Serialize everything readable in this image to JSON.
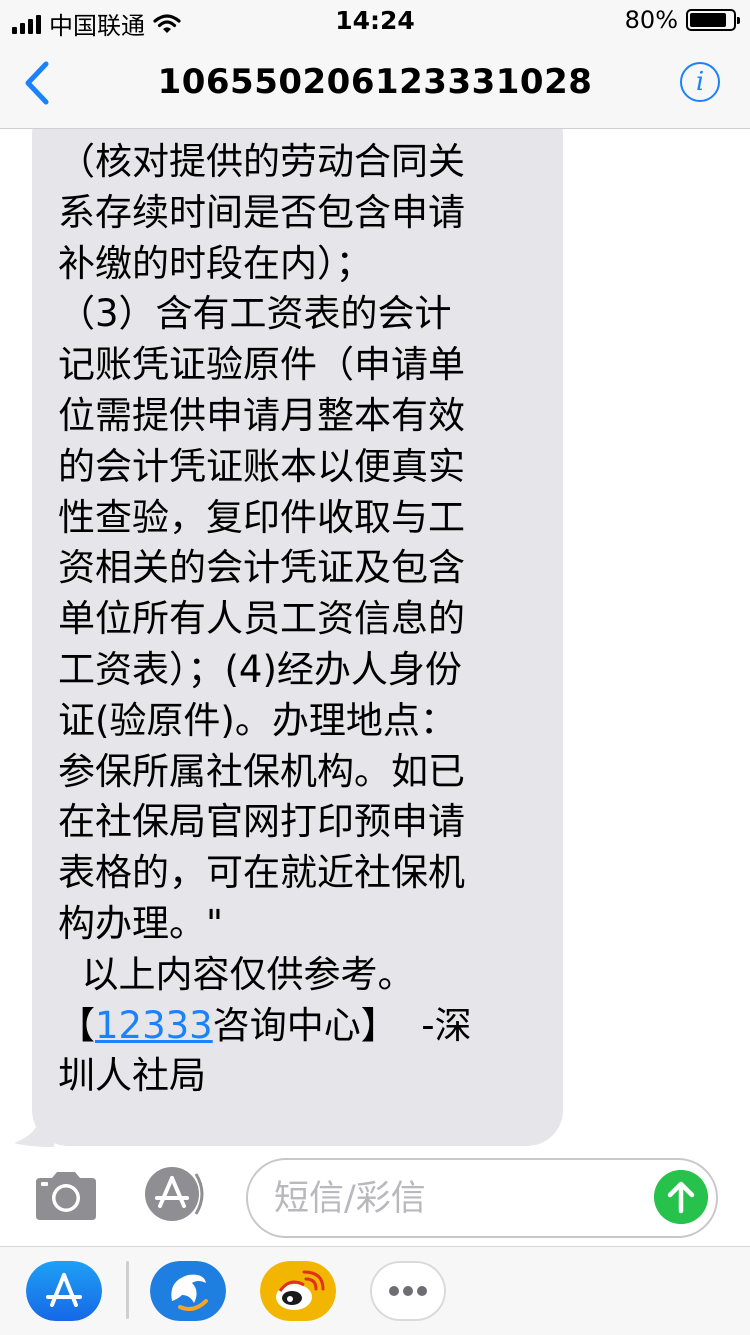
{
  "status_bar": {
    "carrier": "中国联通",
    "time": "14:24",
    "battery": "80%"
  },
  "nav": {
    "title": "106550206123331028",
    "info_label": "i"
  },
  "message": {
    "lines": [
      "（核对提供的劳动合同关",
      "系存续时间是否包含申请",
      "补缴的时段在内）；",
      "（3）含有工资表的会计",
      "记账凭证验原件（申请单",
      "位需提供申请月整本有效",
      "的会计凭证账本以便真实",
      "性查验，复印件收取与工",
      "资相关的会计凭证及包含",
      "单位所有人员工资信息的",
      "工资表）；(4)经办人身份",
      "证(验原件)。办理地点：",
      "参保所属社保机构。如已",
      "在社保局官网打印预申请",
      "表格的，可在就近社保机",
      "构办理。\"",
      "",
      "  以上内容仅供参考。"
    ],
    "footer_prefix": "【",
    "footer_link": "12333",
    "footer_suffix": "咨询中心】  -深",
    "last_line": "圳人社局"
  },
  "input_bar": {
    "placeholder": "短信/彩信",
    "camera_icon": "camera-icon",
    "apps_icon": "app-store-icon",
    "send_icon": "send-arrow-icon"
  },
  "app_tray": {
    "icons": [
      "app-store-icon",
      "dolphin-app-icon",
      "weibo-icon",
      "more-icon"
    ]
  },
  "colors": {
    "accent": "#1a82fb",
    "bubble": "#e5e5ea",
    "send": "#27c24c",
    "weibo": "#f2b600"
  }
}
